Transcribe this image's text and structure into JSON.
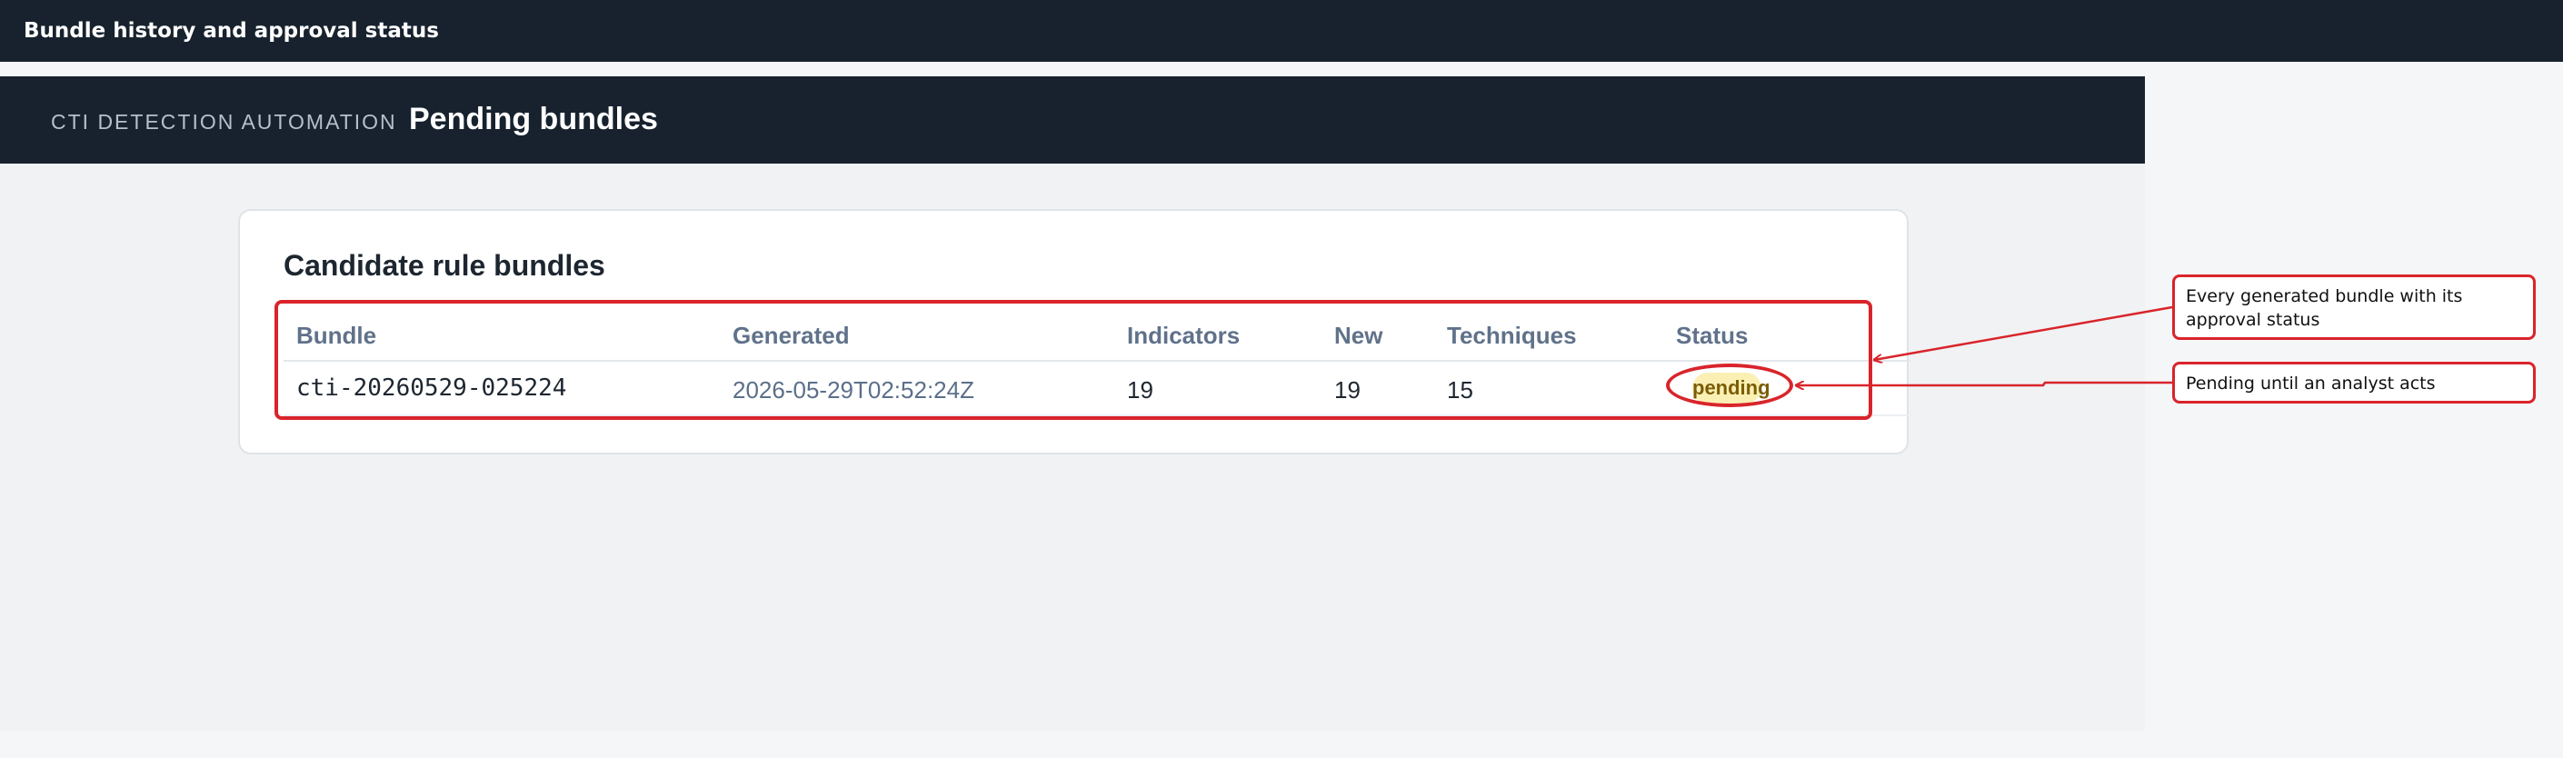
{
  "window": {
    "title": "Bundle history and approval status"
  },
  "header": {
    "brand": "CTI DETECTION AUTOMATION",
    "page_title": "Pending bundles"
  },
  "card": {
    "title": "Candidate rule bundles",
    "columns": [
      "Bundle",
      "Generated",
      "Indicators",
      "New",
      "Techniques",
      "Status"
    ],
    "rows": [
      {
        "bundle": "cti-20260529-025224",
        "generated": "2026-05-29T02:52:24Z",
        "indicators": "19",
        "new": "19",
        "techniques": "15",
        "status": "pending"
      }
    ]
  },
  "annotations": {
    "note_table": "Every generated bundle with its approval status",
    "note_status": "Pending until an analyst acts",
    "color": "#d9242b"
  },
  "colors": {
    "navy": "#17222e",
    "badge_bg": "#fbf0b4",
    "badge_text": "#7b5d05",
    "header_text": "#60728a"
  }
}
